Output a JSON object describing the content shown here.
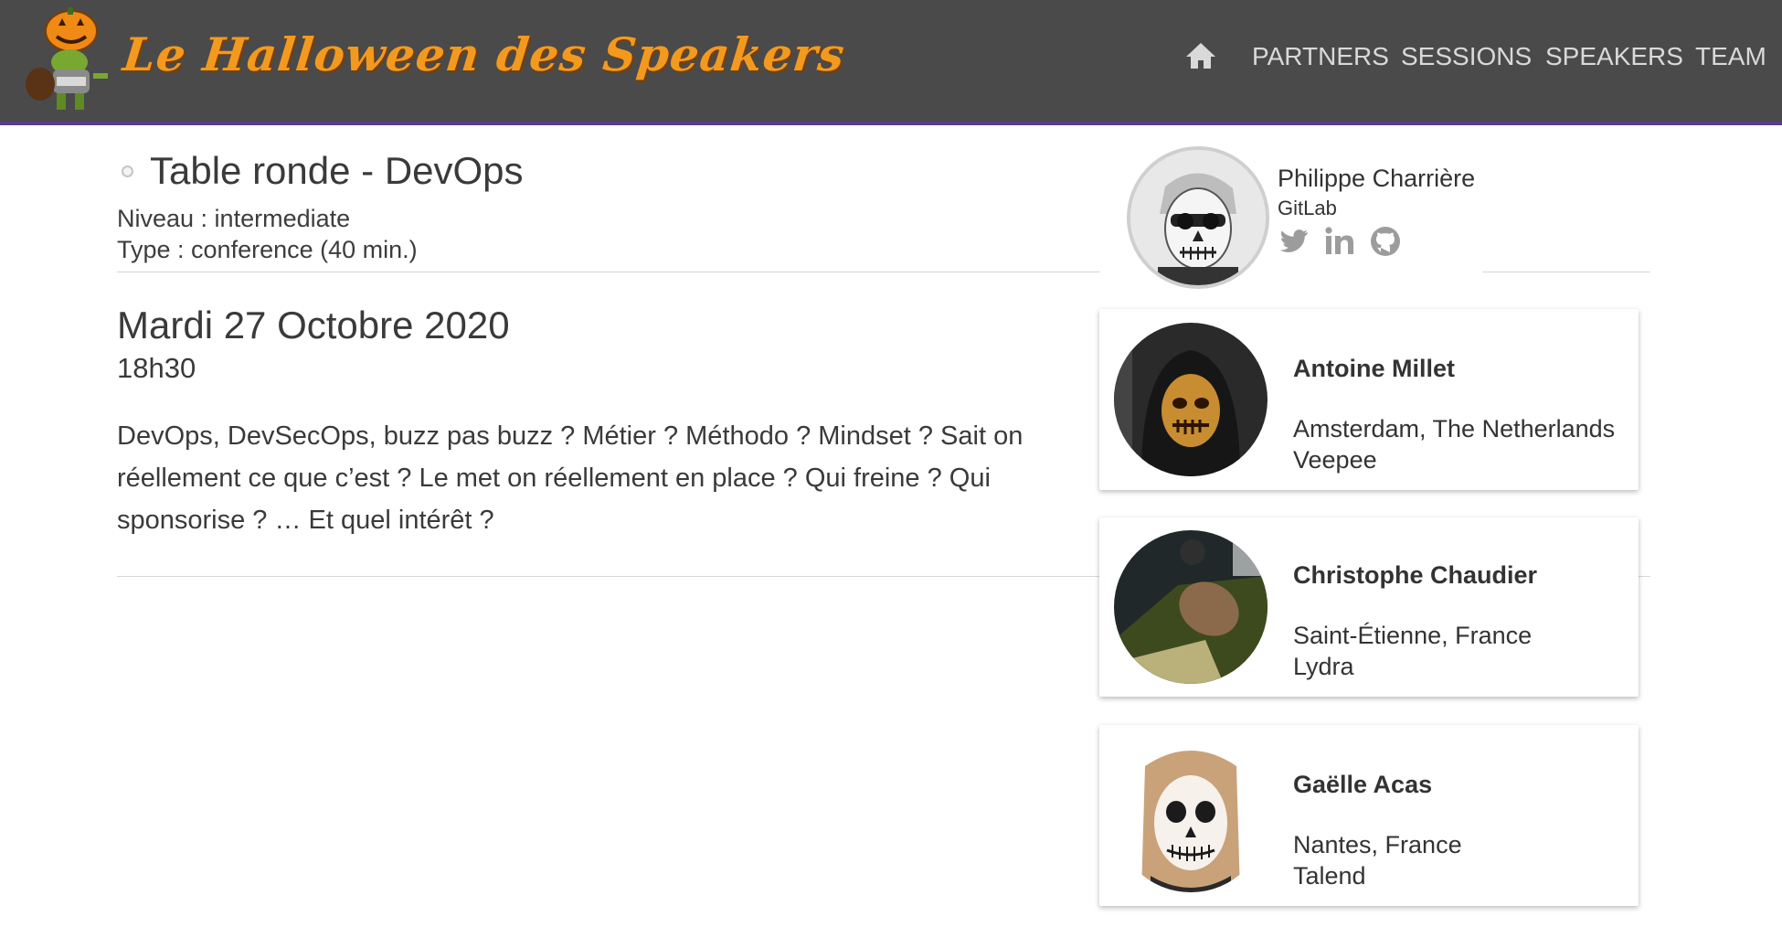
{
  "header": {
    "brand": "Le Halloween des Speakers",
    "home_icon": "home-icon",
    "nav": [
      "PARTNERS",
      "SESSIONS",
      "SPEAKERS",
      "TEAM"
    ],
    "colors": {
      "bar": "#4a4a4a",
      "accent": "#5b3d8f",
      "brand": "#f39a1e"
    }
  },
  "session": {
    "title": "Table ronde - DevOps",
    "level": "Niveau : intermediate",
    "type": "Type : conference (40 min.)",
    "date": "Mardi 27 Octobre 2020",
    "time": "18h30",
    "description": "DevOps, DevSecOps, buzz pas buzz ? Métier ? Méthodo ? Mindset ? Sait on réellement ce que c’est ? Le met on réellement en place ? Qui freine ? Qui sponsorise ? … Et quel intérêt ?"
  },
  "moderator": {
    "name": "Philippe Charrière",
    "company": "GitLab",
    "social": [
      "twitter-icon",
      "linkedin-icon",
      "github-icon"
    ]
  },
  "speakers": [
    {
      "name": "Antoine Millet",
      "location": "Amsterdam, The Netherlands",
      "company": "Veepee"
    },
    {
      "name": "Christophe Chaudier",
      "location": "Saint-Étienne, France",
      "company": "Lydra"
    },
    {
      "name": "Gaëlle Acas",
      "location": "Nantes, France",
      "company": "Talend"
    }
  ]
}
